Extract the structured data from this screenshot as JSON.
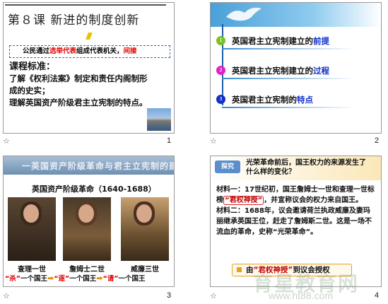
{
  "slides": [
    {
      "number": "1",
      "title": "第８课 新进的制度创新",
      "box": {
        "pre": "公民通过",
        "kw1": "选举代表",
        "mid": "组成代表机关，",
        "kw2": "间接"
      },
      "heading": "课程标准：",
      "lines": [
        "了解《权利法案》制定和责任内阁制形",
        "成的史实；",
        "理解英国资产阶级君主立宪制的特点。"
      ]
    },
    {
      "number": "2",
      "items": [
        {
          "num": "1",
          "pre": "英国君主立宪制建立的",
          "kw": "前提",
          "color": "#7ac223"
        },
        {
          "num": "2",
          "pre": "英国君主立宪制建立的",
          "kw": "过程",
          "color": "#e020c8"
        },
        {
          "num": "3",
          "pre": "英国君主立宪制的",
          "kw": "特点",
          "color": "#1030c8"
        }
      ]
    },
    {
      "number": "3",
      "banner": "一英国资产阶级革命与君主立宪制的建立",
      "subtitle": "英国资产阶级革命（1640-1688）",
      "people": [
        "查理一世",
        "詹姆士二世",
        "威廉三世"
      ],
      "row": {
        "q1": "“杀”",
        "t1": "一个国王",
        "q2": "“逐”",
        "t2": "一个国王",
        "q3": "“请”",
        "t3": "一个国王"
      }
    },
    {
      "number": "4",
      "tag": "探究",
      "question": "光荣革命前后，国王权力的来源发生了什么样的变化？",
      "m1": {
        "a": "材料一：17世纪初，国王詹姆士一世和查理一世标榜",
        "hl": "“君权神授”",
        "b": "，并宣称议会的权力来自国王。"
      },
      "m2": "材料二：1688年，议会邀请荷兰执政威廉及妻玛丽继承英国王位，赶走了詹姆斯二世。这是一场不流血的革命，史称“光荣革命”。",
      "box": {
        "pre": "由",
        "kw": "“君权神授”",
        "post": "到议会授权"
      }
    }
  ],
  "star": "☆",
  "watermark": {
    "cn": "育星教育网",
    "url": "www.ht88.com"
  }
}
